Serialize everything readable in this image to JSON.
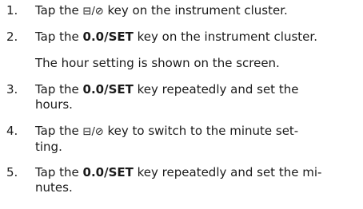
{
  "steps": [
    {
      "number": "1.",
      "before": "Tap the ",
      "key": "⊟/⊘",
      "after": " key on the instrument cluster."
    },
    {
      "number": "2.",
      "before": "Tap the ",
      "key": "0.0/SET",
      "after": " key on the instrument cluster.",
      "note": "The hour setting is shown on the screen."
    },
    {
      "number": "3.",
      "before": "Tap the ",
      "key": "0.0/SET",
      "after": " key repeatedly and set the",
      "line2": "hours."
    },
    {
      "number": "4.",
      "before": "Tap the ",
      "key": "⊟/⊘",
      "after": " key to switch to the minute set-",
      "line2": "ting."
    },
    {
      "number": "5.",
      "before": "Tap the ",
      "key": "0.0/SET",
      "after": " key repeatedly and set the mi-",
      "line2": "nutes."
    }
  ]
}
